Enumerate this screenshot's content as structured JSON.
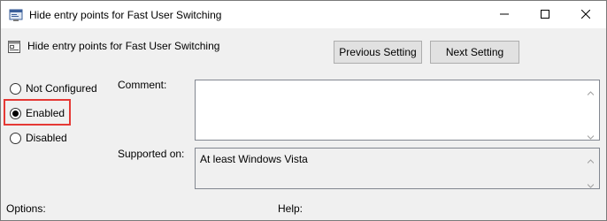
{
  "window": {
    "title": "Hide entry points for Fast User Switching"
  },
  "header": {
    "policy_name": "Hide entry points for Fast User Switching",
    "prev_button": "Previous Setting",
    "next_button": "Next Setting"
  },
  "state": {
    "options": [
      "Not Configured",
      "Enabled",
      "Disabled"
    ],
    "selected": "Enabled"
  },
  "comment": {
    "label": "Comment:",
    "value": ""
  },
  "supported": {
    "label": "Supported on:",
    "value": "At least Windows Vista"
  },
  "bottom": {
    "options_label": "Options:",
    "help_label": "Help:"
  },
  "colors": {
    "highlight": "#e53935",
    "button_face": "#e1e1e1",
    "dialog_bg": "#f0f0f0"
  }
}
